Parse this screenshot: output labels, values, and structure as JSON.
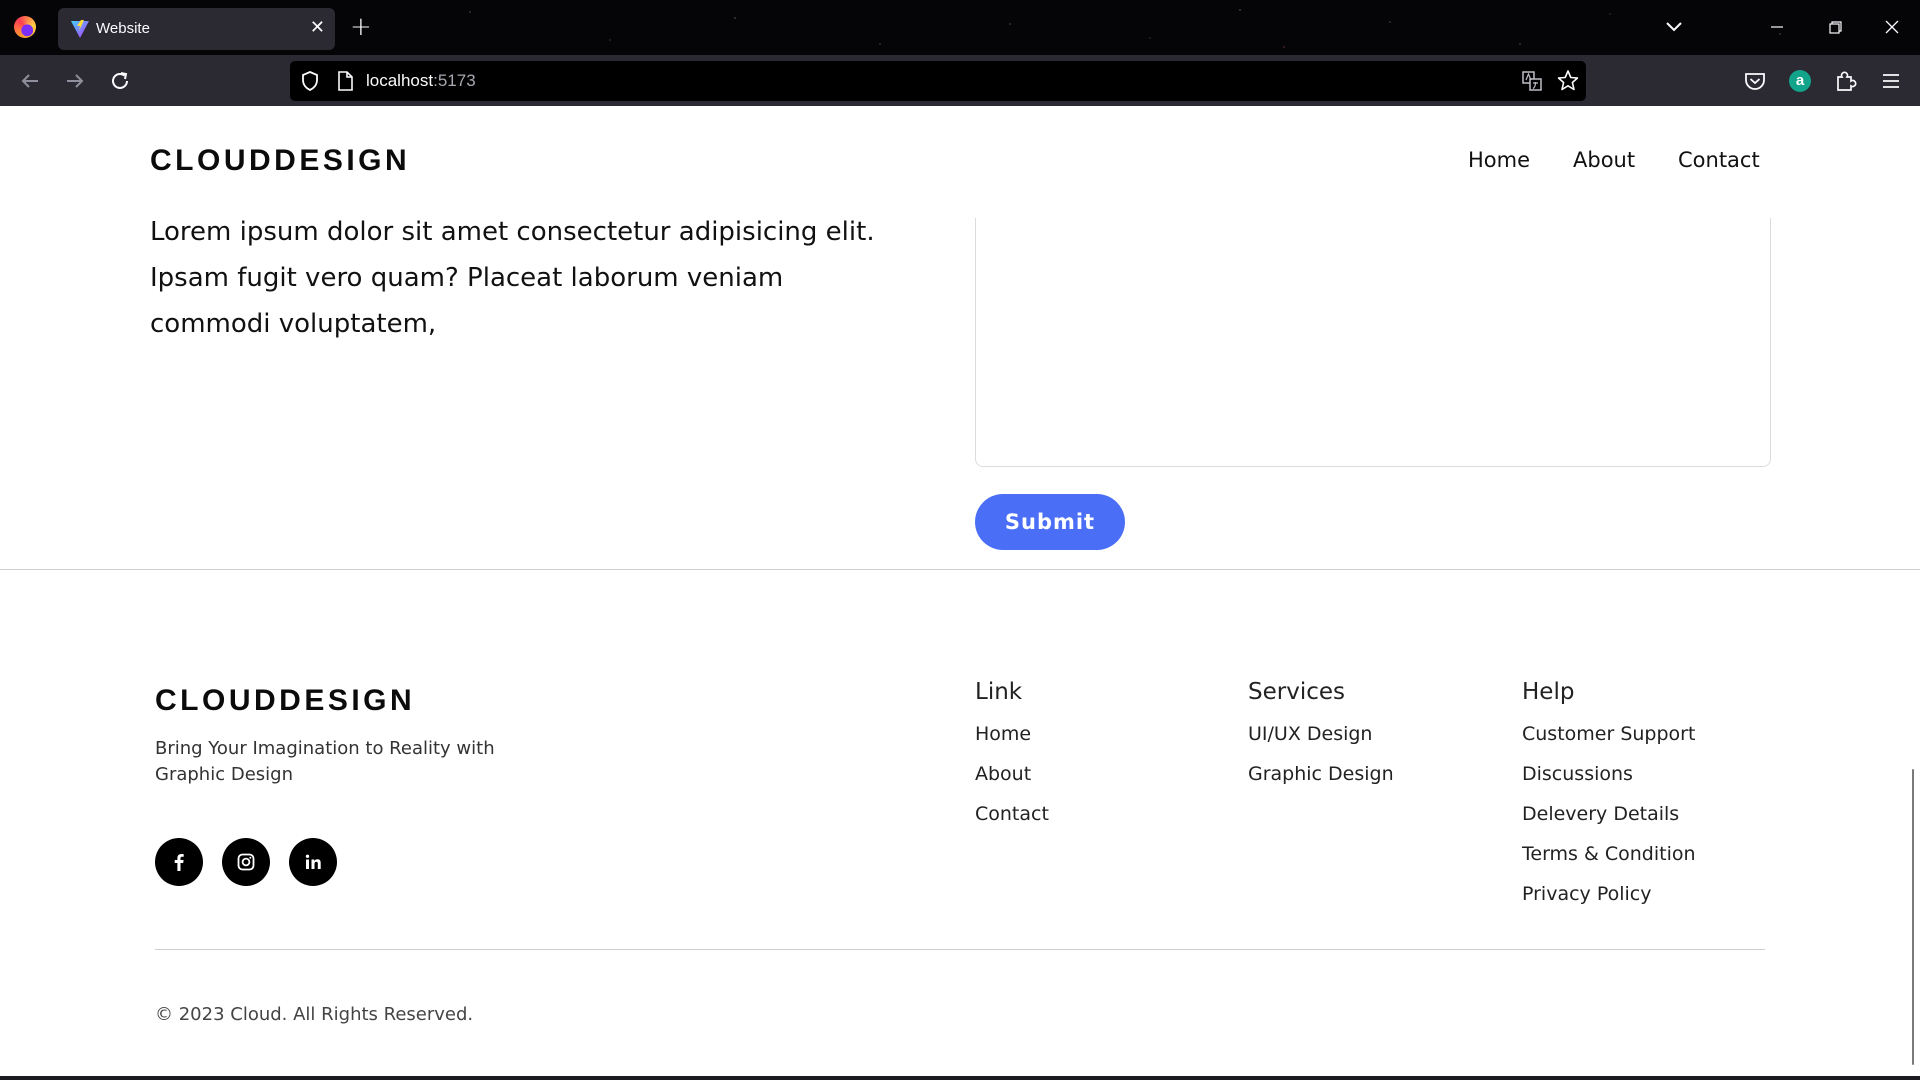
{
  "browser": {
    "tab_title": "Website",
    "url_host": "localhost",
    "url_port": ":5173"
  },
  "header": {
    "brand": "CLOUDDESIGN",
    "nav": [
      "Home",
      "About",
      "Contact"
    ]
  },
  "contact": {
    "intro_lines": [
      "Lorem ipsum dolor sit amet consectetur adipisicing elit.",
      "Ipsam fugit vero quam? Placeat laborum veniam",
      "commodi voluptatem,"
    ],
    "submit_label": "Submit"
  },
  "footer": {
    "brand": "CLOUDDESIGN",
    "tagline_lines": [
      "Bring Your Imagination to Reality with",
      "Graphic Design"
    ],
    "social": [
      "facebook-icon",
      "instagram-icon",
      "linkedin-icon"
    ],
    "columns": [
      {
        "title": "Link",
        "links": [
          "Home",
          "About",
          "Contact"
        ]
      },
      {
        "title": "Services",
        "links": [
          "UI/UX Design",
          "Graphic Design"
        ]
      },
      {
        "title": "Help",
        "links": [
          "Customer Support",
          "Discussions",
          "Delevery Details",
          "Terms & Condition",
          "Privacy Policy"
        ]
      }
    ],
    "copyright": "© 2023 Cloud. All Rights Reserved."
  },
  "colors": {
    "accent": "#4a6ef5",
    "chrome_dark": "#2b2a33",
    "text": "#111111"
  }
}
